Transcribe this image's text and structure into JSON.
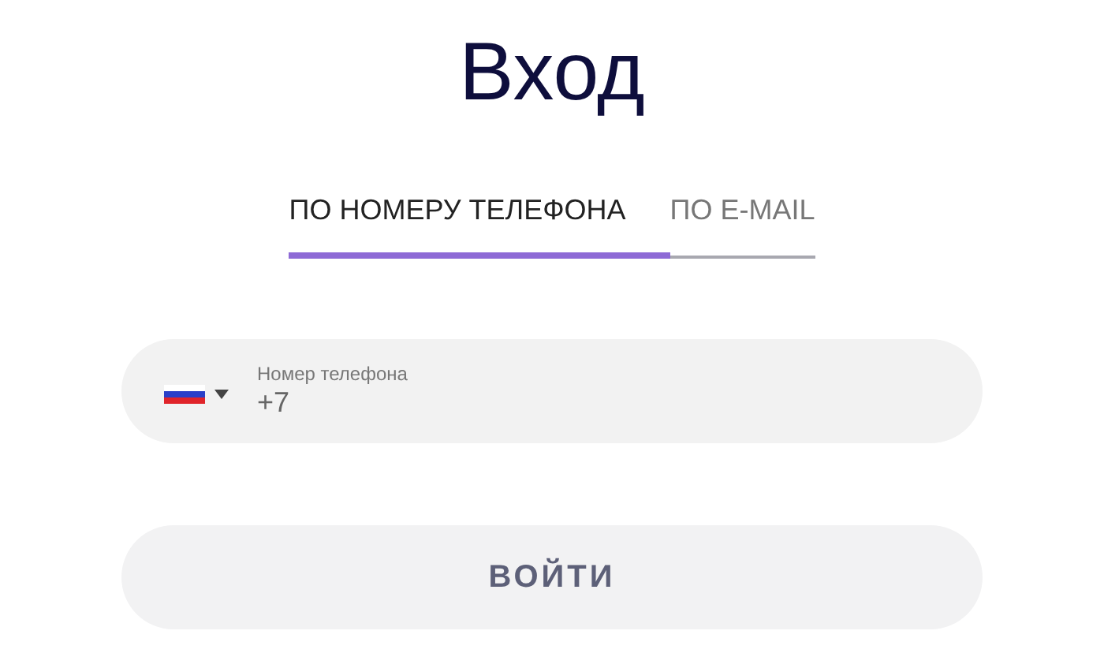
{
  "title": "Вход",
  "tabs": [
    {
      "label": "ПО НОМЕРУ ТЕЛЕФОНА",
      "selected": true
    },
    {
      "label": "ПО E-MAIL",
      "selected": false
    }
  ],
  "phone_field": {
    "label": "Номер телефона",
    "value": "+7"
  },
  "submit_button": "ВОЙТИ"
}
